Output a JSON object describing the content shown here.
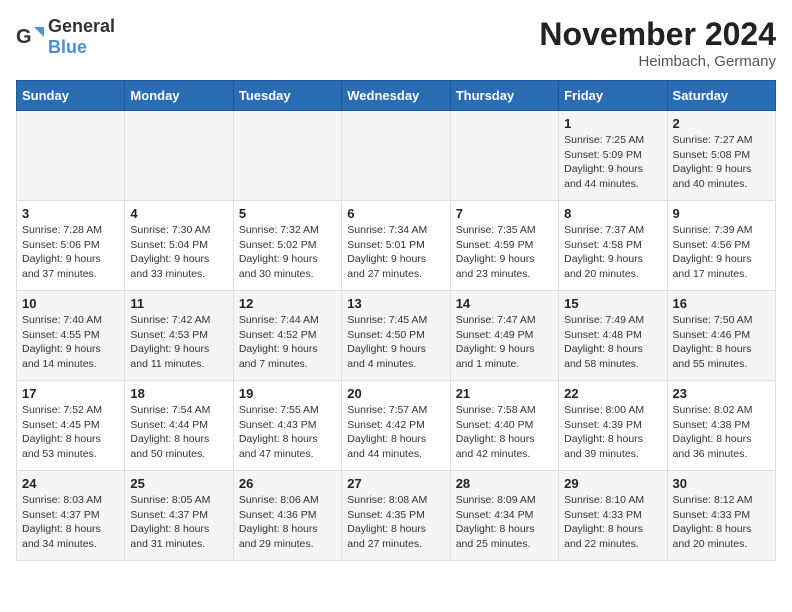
{
  "header": {
    "logo_general": "General",
    "logo_blue": "Blue",
    "month_title": "November 2024",
    "location": "Heimbach, Germany"
  },
  "days_of_week": [
    "Sunday",
    "Monday",
    "Tuesday",
    "Wednesday",
    "Thursday",
    "Friday",
    "Saturday"
  ],
  "weeks": [
    {
      "days": [
        {
          "num": "",
          "info": ""
        },
        {
          "num": "",
          "info": ""
        },
        {
          "num": "",
          "info": ""
        },
        {
          "num": "",
          "info": ""
        },
        {
          "num": "",
          "info": ""
        },
        {
          "num": "1",
          "info": "Sunrise: 7:25 AM\nSunset: 5:09 PM\nDaylight: 9 hours\nand 44 minutes."
        },
        {
          "num": "2",
          "info": "Sunrise: 7:27 AM\nSunset: 5:08 PM\nDaylight: 9 hours\nand 40 minutes."
        }
      ]
    },
    {
      "days": [
        {
          "num": "3",
          "info": "Sunrise: 7:28 AM\nSunset: 5:06 PM\nDaylight: 9 hours\nand 37 minutes."
        },
        {
          "num": "4",
          "info": "Sunrise: 7:30 AM\nSunset: 5:04 PM\nDaylight: 9 hours\nand 33 minutes."
        },
        {
          "num": "5",
          "info": "Sunrise: 7:32 AM\nSunset: 5:02 PM\nDaylight: 9 hours\nand 30 minutes."
        },
        {
          "num": "6",
          "info": "Sunrise: 7:34 AM\nSunset: 5:01 PM\nDaylight: 9 hours\nand 27 minutes."
        },
        {
          "num": "7",
          "info": "Sunrise: 7:35 AM\nSunset: 4:59 PM\nDaylight: 9 hours\nand 23 minutes."
        },
        {
          "num": "8",
          "info": "Sunrise: 7:37 AM\nSunset: 4:58 PM\nDaylight: 9 hours\nand 20 minutes."
        },
        {
          "num": "9",
          "info": "Sunrise: 7:39 AM\nSunset: 4:56 PM\nDaylight: 9 hours\nand 17 minutes."
        }
      ]
    },
    {
      "days": [
        {
          "num": "10",
          "info": "Sunrise: 7:40 AM\nSunset: 4:55 PM\nDaylight: 9 hours\nand 14 minutes."
        },
        {
          "num": "11",
          "info": "Sunrise: 7:42 AM\nSunset: 4:53 PM\nDaylight: 9 hours\nand 11 minutes."
        },
        {
          "num": "12",
          "info": "Sunrise: 7:44 AM\nSunset: 4:52 PM\nDaylight: 9 hours\nand 7 minutes."
        },
        {
          "num": "13",
          "info": "Sunrise: 7:45 AM\nSunset: 4:50 PM\nDaylight: 9 hours\nand 4 minutes."
        },
        {
          "num": "14",
          "info": "Sunrise: 7:47 AM\nSunset: 4:49 PM\nDaylight: 9 hours\nand 1 minute."
        },
        {
          "num": "15",
          "info": "Sunrise: 7:49 AM\nSunset: 4:48 PM\nDaylight: 8 hours\nand 58 minutes."
        },
        {
          "num": "16",
          "info": "Sunrise: 7:50 AM\nSunset: 4:46 PM\nDaylight: 8 hours\nand 55 minutes."
        }
      ]
    },
    {
      "days": [
        {
          "num": "17",
          "info": "Sunrise: 7:52 AM\nSunset: 4:45 PM\nDaylight: 8 hours\nand 53 minutes."
        },
        {
          "num": "18",
          "info": "Sunrise: 7:54 AM\nSunset: 4:44 PM\nDaylight: 8 hours\nand 50 minutes."
        },
        {
          "num": "19",
          "info": "Sunrise: 7:55 AM\nSunset: 4:43 PM\nDaylight: 8 hours\nand 47 minutes."
        },
        {
          "num": "20",
          "info": "Sunrise: 7:57 AM\nSunset: 4:42 PM\nDaylight: 8 hours\nand 44 minutes."
        },
        {
          "num": "21",
          "info": "Sunrise: 7:58 AM\nSunset: 4:40 PM\nDaylight: 8 hours\nand 42 minutes."
        },
        {
          "num": "22",
          "info": "Sunrise: 8:00 AM\nSunset: 4:39 PM\nDaylight: 8 hours\nand 39 minutes."
        },
        {
          "num": "23",
          "info": "Sunrise: 8:02 AM\nSunset: 4:38 PM\nDaylight: 8 hours\nand 36 minutes."
        }
      ]
    },
    {
      "days": [
        {
          "num": "24",
          "info": "Sunrise: 8:03 AM\nSunset: 4:37 PM\nDaylight: 8 hours\nand 34 minutes."
        },
        {
          "num": "25",
          "info": "Sunrise: 8:05 AM\nSunset: 4:37 PM\nDaylight: 8 hours\nand 31 minutes."
        },
        {
          "num": "26",
          "info": "Sunrise: 8:06 AM\nSunset: 4:36 PM\nDaylight: 8 hours\nand 29 minutes."
        },
        {
          "num": "27",
          "info": "Sunrise: 8:08 AM\nSunset: 4:35 PM\nDaylight: 8 hours\nand 27 minutes."
        },
        {
          "num": "28",
          "info": "Sunrise: 8:09 AM\nSunset: 4:34 PM\nDaylight: 8 hours\nand 25 minutes."
        },
        {
          "num": "29",
          "info": "Sunrise: 8:10 AM\nSunset: 4:33 PM\nDaylight: 8 hours\nand 22 minutes."
        },
        {
          "num": "30",
          "info": "Sunrise: 8:12 AM\nSunset: 4:33 PM\nDaylight: 8 hours\nand 20 minutes."
        }
      ]
    }
  ]
}
